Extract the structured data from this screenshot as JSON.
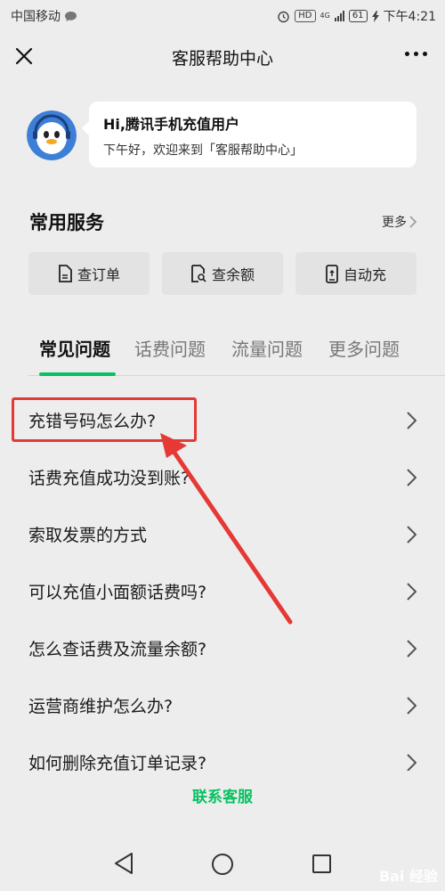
{
  "status_bar": {
    "carrier": "中国移动",
    "hd": "HD",
    "network": "4G",
    "battery": "61",
    "time": "下午4:21"
  },
  "header": {
    "title": "客服帮助中心",
    "close_icon": "close-icon",
    "more_icon": "more-dots-icon"
  },
  "greeting": {
    "title": "Hi,腾讯手机充值用户",
    "subtitle": "下午好，欢迎来到「客服帮助中心」"
  },
  "services": {
    "title": "常用服务",
    "more_label": "更多",
    "items": [
      {
        "label": "查订单",
        "icon": "document-icon"
      },
      {
        "label": "查余额",
        "icon": "search-document-icon"
      },
      {
        "label": "自动充",
        "icon": "phone-recharge-icon"
      }
    ]
  },
  "tabs": [
    {
      "label": "常见问题",
      "active": true
    },
    {
      "label": "话费问题",
      "active": false
    },
    {
      "label": "流量问题",
      "active": false
    },
    {
      "label": "更多问题",
      "active": false
    }
  ],
  "faq": [
    {
      "label": "充错号码怎么办?"
    },
    {
      "label": "话费充值成功没到账?"
    },
    {
      "label": "索取发票的方式"
    },
    {
      "label": "可以充值小面额话费吗?"
    },
    {
      "label": "怎么查话费及流量余额?"
    },
    {
      "label": "运营商维护怎么办?"
    },
    {
      "label": "如何删除充值订单记录?"
    }
  ],
  "contact_label": "联系客服",
  "watermark": "Bai 经验",
  "colors": {
    "accent": "#07c160",
    "annotation": "#e53935",
    "background": "#ededed"
  }
}
